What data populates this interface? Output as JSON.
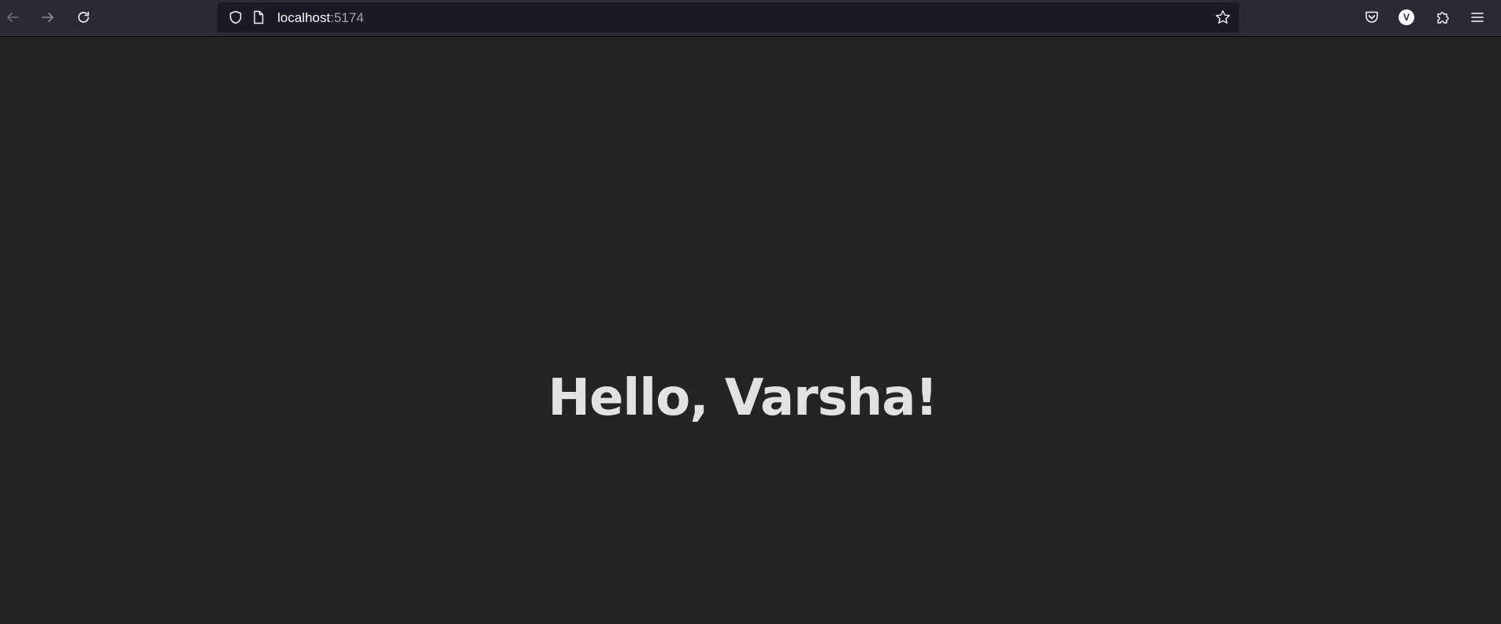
{
  "browser": {
    "url": {
      "host": "localhost",
      "port": ":5174"
    },
    "account_initial": "V",
    "icons": {
      "back": "arrow-left-icon",
      "forward": "arrow-right-icon",
      "reload": "reload-icon",
      "tracking_protection": "shield-icon",
      "page_info": "page-icon",
      "bookmark": "star-icon",
      "pocket": "pocket-icon",
      "extensions": "puzzle-icon",
      "menu": "hamburger-menu-icon"
    },
    "colors": {
      "toolbar": "#2b2a33",
      "urlbar": "#1c1b22",
      "page_background": "#242424"
    }
  },
  "page": {
    "greeting": "Hello, Varsha!"
  }
}
